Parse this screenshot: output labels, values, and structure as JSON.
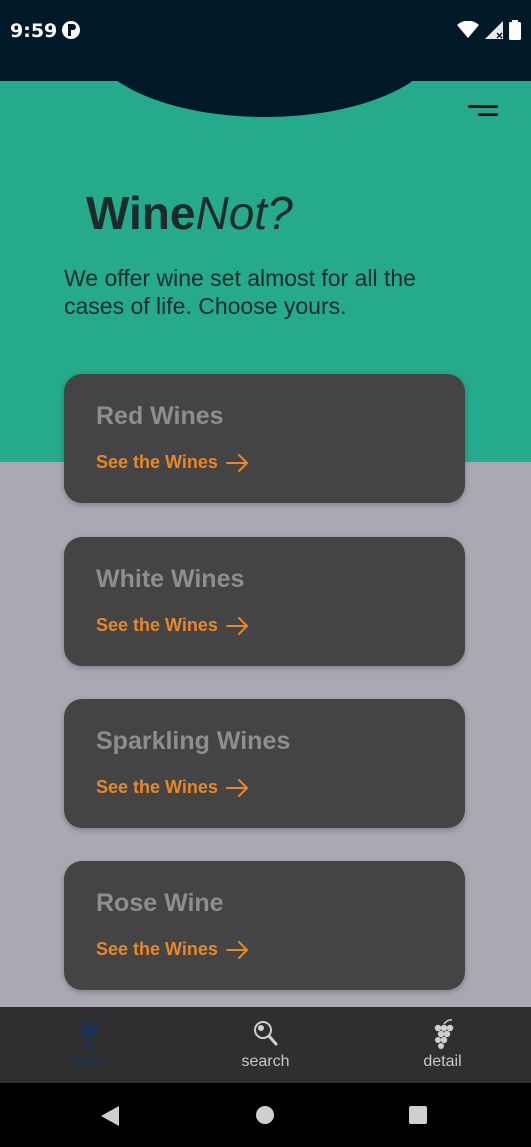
{
  "status_bar": {
    "time": "9:59"
  },
  "header": {
    "brand_bold": "Wine",
    "brand_italic": "Not?",
    "tagline": "We offer wine set almost for all the cases of life. Choose yours."
  },
  "cards": [
    {
      "title": "Red Wines",
      "link": "See the Wines"
    },
    {
      "title": "White Wines",
      "link": "See the Wines"
    },
    {
      "title": "Sparkling Wines",
      "link": "See the Wines"
    },
    {
      "title": "Rose Wine",
      "link": "See the Wines"
    }
  ],
  "bottom_nav": {
    "items": [
      {
        "label": "main",
        "icon": "wine-glass-icon",
        "active": true
      },
      {
        "label": "search",
        "icon": "magnifier-icon",
        "active": false
      },
      {
        "label": "detail",
        "icon": "grapes-icon",
        "active": false
      }
    ]
  },
  "colors": {
    "teal": "#25AB8B",
    "dark_navy": "#001929",
    "card_bg": "#444444",
    "accent_orange": "#E8872A",
    "page_bg": "#A9A9B4"
  }
}
